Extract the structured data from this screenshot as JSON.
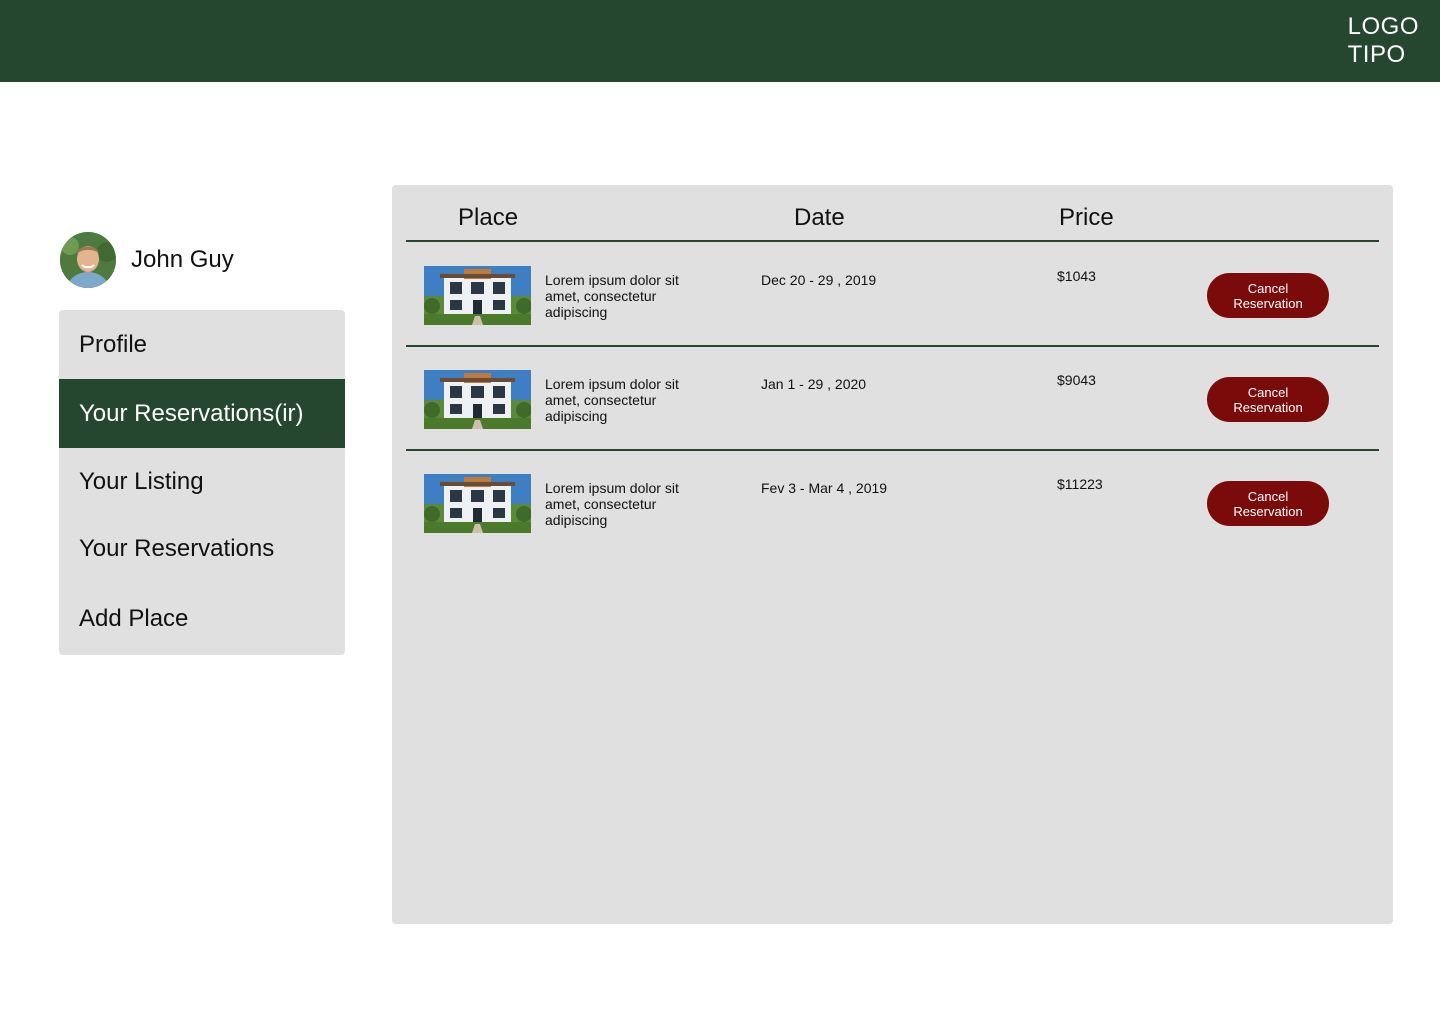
{
  "header": {
    "logo_line1": "LOGO",
    "logo_line2": "TIPO"
  },
  "user": {
    "name": "John Guy"
  },
  "sidebar": {
    "items": [
      {
        "label": "Profile",
        "active": false
      },
      {
        "label": "Your Reservations(ir)",
        "active": true
      },
      {
        "label": "Your Listing",
        "active": false
      },
      {
        "label": "Your Reservations",
        "active": false
      },
      {
        "label": "Add Place",
        "active": false
      }
    ]
  },
  "table": {
    "headers": [
      "Place",
      "Date",
      "Price"
    ],
    "rows": [
      {
        "description": "Lorem ipsum dolor sit amet, consectetur adipiscing",
        "date": "Dec 20 - 29 , 2019",
        "price": "$1043",
        "action": "Cancel Reservation"
      },
      {
        "description": "Lorem ipsum dolor sit amet, consectetur adipiscing",
        "date": "Jan 1 - 29 , 2020",
        "price": "$9043",
        "action": "Cancel Reservation"
      },
      {
        "description": "Lorem ipsum dolor sit amet, consectetur adipiscing",
        "date": "Fev 3 - Mar 4 , 2019",
        "price": "$11223",
        "action": "Cancel Reservation"
      }
    ]
  },
  "colors": {
    "brand_green": "#254730",
    "panel_gray": "#e0e0e0",
    "cancel_red": "#7b0a0a"
  }
}
